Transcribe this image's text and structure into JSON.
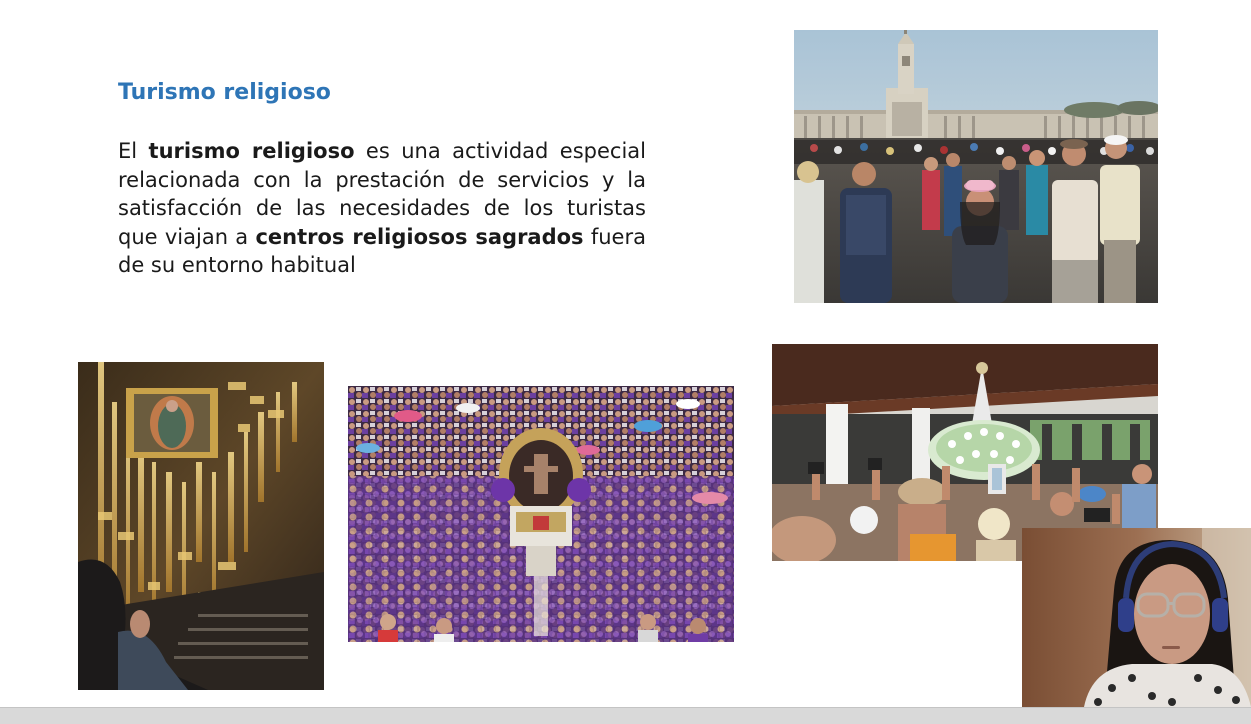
{
  "slide": {
    "title": "Turismo religioso",
    "paragraph": {
      "t1": "El ",
      "b1": "turismo religioso",
      "t2": " es una actividad especial relacionada con la prestación de servicios y la satisfacción de las necesidades de los turistas que viajan a ",
      "b2": "centros religiosos sagrados",
      "t3": " fuera de su entorno habitual"
    }
  },
  "colors": {
    "title": "#2e75b6",
    "text": "#1a1a1a",
    "bottom_bar": "#d9d9d9"
  }
}
